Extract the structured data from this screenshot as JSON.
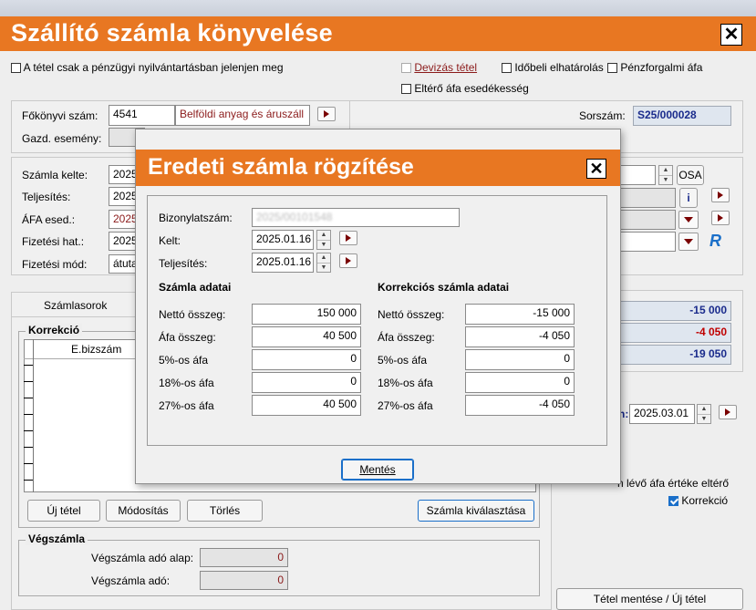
{
  "window": {
    "title": "Szállító számla könyvelése"
  },
  "options": {
    "penzugyi_only": "A tétel csak a pénzügyi nyilvántartásban jelenjen meg",
    "devizas": "Devizás tétel",
    "idobeli": "Időbeli elhatárolás",
    "penzforgalmi": "Pénzforgalmi áfa",
    "eltero_afa": "Eltérő áfa esedékesség"
  },
  "header": {
    "fokonyvi_label": "Főkönyvi szám:",
    "fokonyvi_value": "4541",
    "fokonyvi_name": "Belföldi anyag és áruszáll",
    "gazd_label": "Gazd. esemény:",
    "sorszam_label": "Sorszám:",
    "sorszam_value": "S25/000028"
  },
  "dates": {
    "szamla_kelte_label": "Számla kelte:",
    "teljesites_label": "Teljesítés:",
    "afa_esed_label": "ÁFA esed.:",
    "fizetesi_hat_label": "Fizetési hat.:",
    "fizetesi_mod_label": "Fizetési mód:",
    "v1": "2025",
    "v2": "2025",
    "v3": "2025",
    "v4": "2025",
    "v5": "átuta",
    "osa": "OSA",
    "info": "i",
    "r_logo": "R"
  },
  "tabs": {
    "szamlasorok": "Számlasorok"
  },
  "korrekcio": {
    "title": "Korrekció",
    "col": "E.bizszám",
    "btn_uj": "Új tétel",
    "btn_mod": "Módosítás",
    "btn_torles": "Törlés",
    "btn_valaszt": "Számla kiválasztása"
  },
  "right_totals": {
    "v1": "-15 000",
    "v2": "-4 050",
    "v3": "-19 050"
  },
  "right_misc": {
    "date_label_tail": "n:",
    "date_value": "2025.03.01",
    "eltero_text": "n lévő áfa értéke eltérő",
    "korrekcio_label": "Korrekció",
    "save_btn": "Tétel mentése / Új tétel"
  },
  "vegszamla": {
    "title": "Végszámla",
    "ado_alap_label": "Végszámla adó alap:",
    "ado_alap_value": "0",
    "ado_label": "Végszámla adó:",
    "ado_value": "0"
  },
  "dialog": {
    "title": "Eredeti számla rögzítése",
    "bizonylat_label": "Bizonylatszám:",
    "bizonylat_value": "2025/00101548",
    "kelt_label": "Kelt:",
    "kelt_value": "2025.01.16",
    "teljesites_label": "Teljesítés:",
    "teljesites_value": "2025.01.16",
    "left_header": "Számla adatai",
    "right_header": "Korrekciós számla adatai",
    "rows": [
      {
        "label": "Nettó összeg:",
        "left": "150 000",
        "right": "-15 000"
      },
      {
        "label": "Áfa összeg:",
        "left": "40 500",
        "right": "-4 050"
      },
      {
        "label": "5%-os áfa",
        "left": "0",
        "right": "0"
      },
      {
        "label": "18%-os áfa",
        "left": "0",
        "right": "0"
      },
      {
        "label": "27%-os áfa",
        "left": "40 500",
        "right": "-4 050"
      }
    ],
    "save_button": "Mentés"
  },
  "colors": {
    "accent": "#e87722",
    "dark_red": "#7a0000",
    "navy": "#1a2b8c"
  }
}
